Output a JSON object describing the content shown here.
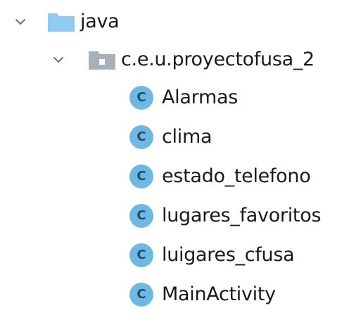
{
  "colors": {
    "text": "#1a1a1a",
    "chevron": "#6e6e6e",
    "java_folder": "#8fcaf0",
    "package_folder": "#a9b1b8",
    "package_dot": "#ffffff",
    "class_badge": "#6fb8e3",
    "class_letter": "#1e4e6e"
  },
  "tree": {
    "java": {
      "icon": "source-folder-icon",
      "expanded": true,
      "label": "java"
    },
    "package": {
      "icon": "package-folder-icon",
      "expanded": true,
      "label": "c.e.u.proyectofusa_2"
    },
    "class_badge_letter": "C",
    "classes": [
      {
        "label": "Alarmas"
      },
      {
        "label": "clima"
      },
      {
        "label": "estado_telefono"
      },
      {
        "label": "lugares_favoritos"
      },
      {
        "label": "luigares_cfusa"
      },
      {
        "label": "MainActivity"
      }
    ]
  }
}
